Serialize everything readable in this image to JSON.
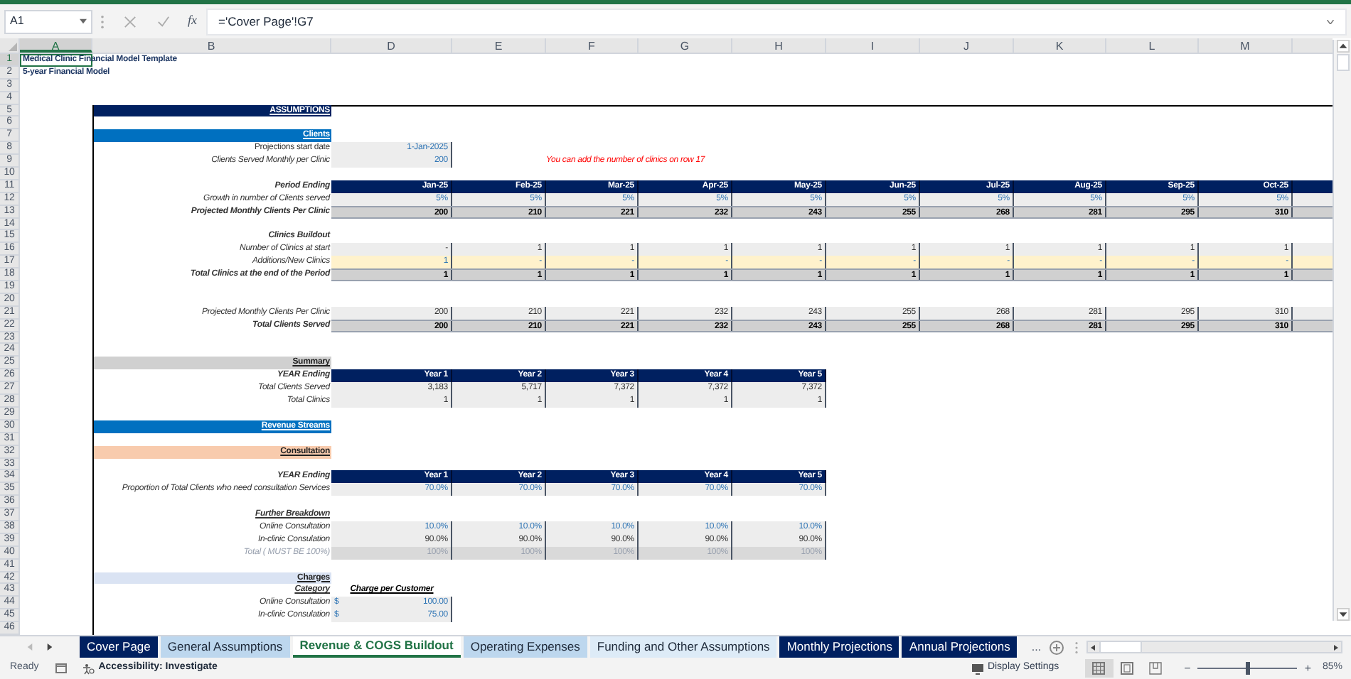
{
  "formula_bar": {
    "name_box": "A1",
    "function_label": "fx",
    "formula": "='Cover Page'!G7"
  },
  "columns": [
    {
      "label": "A",
      "selected": true
    },
    {
      "label": "B",
      "selected": false
    },
    {
      "label": "D",
      "selected": false
    },
    {
      "label": "E",
      "selected": false
    },
    {
      "label": "F",
      "selected": false
    },
    {
      "label": "G",
      "selected": false
    },
    {
      "label": "H",
      "selected": false
    },
    {
      "label": "I",
      "selected": false
    },
    {
      "label": "J",
      "selected": false
    },
    {
      "label": "K",
      "selected": false
    },
    {
      "label": "L",
      "selected": false
    },
    {
      "label": "M",
      "selected": false
    }
  ],
  "rows": [
    {
      "n": "1",
      "selected": true,
      "kind": "title",
      "label": "Medical Clinic Financial Model Template"
    },
    {
      "n": "2",
      "selected": false,
      "kind": "title",
      "label": "5-year Financial  Model"
    },
    {
      "n": "3",
      "selected": false,
      "kind": "blank"
    },
    {
      "n": "4",
      "selected": false,
      "kind": "blank"
    },
    {
      "n": "5",
      "selected": false,
      "kind": "band",
      "color": "#002060",
      "label": "ASSUMPTIONS"
    },
    {
      "n": "6",
      "selected": false,
      "kind": "blank"
    },
    {
      "n": "7",
      "selected": false,
      "kind": "band",
      "color": "#0070c0",
      "label": "Clients"
    },
    {
      "n": "8",
      "selected": false,
      "kind": "date",
      "label": "Projections  start date",
      "values": [
        "1-Jan-2025"
      ]
    },
    {
      "n": "9",
      "selected": false,
      "kind": "input",
      "label": "Clients Served  Monthly per Clinic",
      "values": [
        "200"
      ],
      "note": "You can add the number of clinics on row 17"
    },
    {
      "n": "10",
      "selected": false,
      "kind": "blank"
    },
    {
      "n": "11",
      "selected": false,
      "kind": "header",
      "label": "Period Ending",
      "values": [
        "Jan-25",
        "Feb-25",
        "Mar-25",
        "Apr-25",
        "May-25",
        "Jun-25",
        "Jul-25",
        "Aug-25",
        "Sep-25",
        "Oct-25"
      ]
    },
    {
      "n": "12",
      "selected": false,
      "kind": "input",
      "label": "Growth in number of Clients served",
      "values": [
        "5%",
        "5%",
        "5%",
        "5%",
        "5%",
        "5%",
        "5%",
        "5%",
        "5%",
        "5%"
      ]
    },
    {
      "n": "13",
      "selected": false,
      "kind": "total",
      "label": "Projected  Monthly Clients Per Clinic",
      "values": [
        "200",
        "210",
        "221",
        "232",
        "243",
        "255",
        "268",
        "281",
        "295",
        "310"
      ]
    },
    {
      "n": "14",
      "selected": false,
      "kind": "blank"
    },
    {
      "n": "15",
      "selected": false,
      "kind": "subhead",
      "underlined": false,
      "label": "Clinics Buildout"
    },
    {
      "n": "16",
      "selected": false,
      "kind": "calc",
      "label": "Number of Clinics at start",
      "values": [
        "-",
        "1",
        "1",
        "1",
        "1",
        "1",
        "1",
        "1",
        "1",
        "1"
      ]
    },
    {
      "n": "17",
      "selected": false,
      "kind": "yellow",
      "label": "Additions/New Clinics",
      "values": [
        "1",
        "-",
        "-",
        "-",
        "-",
        "-",
        "-",
        "-",
        "-",
        "-"
      ]
    },
    {
      "n": "18",
      "selected": false,
      "kind": "total",
      "label": "Total Clinics at the end of the  Period",
      "values": [
        "1",
        "1",
        "1",
        "1",
        "1",
        "1",
        "1",
        "1",
        "1",
        "1"
      ]
    },
    {
      "n": "19",
      "selected": false,
      "kind": "blank"
    },
    {
      "n": "20",
      "selected": false,
      "kind": "blank"
    },
    {
      "n": "21",
      "selected": false,
      "kind": "calc",
      "label": "Projected  Monthly Clients Per Clinic",
      "values": [
        "200",
        "210",
        "221",
        "232",
        "243",
        "255",
        "268",
        "281",
        "295",
        "310"
      ]
    },
    {
      "n": "22",
      "selected": false,
      "kind": "total",
      "label": "Total Clients Served",
      "values": [
        "200",
        "210",
        "221",
        "232",
        "243",
        "255",
        "268",
        "281",
        "295",
        "310"
      ]
    },
    {
      "n": "23",
      "selected": false,
      "kind": "blank"
    },
    {
      "n": "24",
      "selected": false,
      "kind": "blank"
    },
    {
      "n": "25",
      "selected": false,
      "kind": "band",
      "color": "#d0d0d0",
      "label": "Summary"
    },
    {
      "n": "26",
      "selected": false,
      "kind": "header",
      "label": "YEAR Ending",
      "values": [
        "Year 1",
        "Year 2",
        "Year 3",
        "Year 4",
        "Year 5"
      ]
    },
    {
      "n": "27",
      "selected": false,
      "kind": "calc",
      "label": "Total Clients Served",
      "values": [
        "3,183",
        "5,717",
        "7,372",
        "7,372",
        "7,372"
      ]
    },
    {
      "n": "28",
      "selected": false,
      "kind": "calc",
      "label": "Total Clinics",
      "values": [
        "1",
        "1",
        "1",
        "1",
        "1"
      ]
    },
    {
      "n": "29",
      "selected": false,
      "kind": "blank"
    },
    {
      "n": "30",
      "selected": false,
      "kind": "band",
      "color": "#0070c0",
      "label": "Revenue Streams"
    },
    {
      "n": "31",
      "selected": false,
      "kind": "blank"
    },
    {
      "n": "32",
      "selected": false,
      "kind": "band",
      "color": "#f8cbad",
      "label": "Consultation"
    },
    {
      "n": "33",
      "selected": false,
      "kind": "blank"
    },
    {
      "n": "34",
      "selected": false,
      "kind": "header",
      "label": "YEAR Ending",
      "values": [
        "Year 1",
        "Year 2",
        "Year 3",
        "Year 4",
        "Year 5"
      ]
    },
    {
      "n": "35",
      "selected": false,
      "kind": "input",
      "label": "Proportion of Total Clients who need consultation Services",
      "values": [
        "70.0%",
        "70.0%",
        "70.0%",
        "70.0%",
        "70.0%"
      ]
    },
    {
      "n": "36",
      "selected": false,
      "kind": "blank"
    },
    {
      "n": "37",
      "selected": false,
      "kind": "subhead",
      "underlined": true,
      "label": "Further Breakdown"
    },
    {
      "n": "38",
      "selected": false,
      "kind": "input",
      "label": "Online Consultation",
      "values": [
        "10.0%",
        "10.0%",
        "10.0%",
        "10.0%",
        "10.0%"
      ]
    },
    {
      "n": "39",
      "selected": false,
      "kind": "calc",
      "label": "In-clinic Consulation",
      "values": [
        "90.0%",
        "90.0%",
        "90.0%",
        "90.0%",
        "90.0%"
      ]
    },
    {
      "n": "40",
      "selected": false,
      "kind": "muted",
      "label": "Total ( MUST BE 100%)",
      "values": [
        "100%",
        "100%",
        "100%",
        "100%",
        "100%"
      ]
    },
    {
      "n": "41",
      "selected": false,
      "kind": "blank"
    },
    {
      "n": "42",
      "selected": false,
      "kind": "band",
      "color": "#dae3f3",
      "label": "Charges"
    },
    {
      "n": "43",
      "selected": false,
      "kind": "colhead",
      "label": "Category",
      "values": [
        "Charge per Customer"
      ]
    },
    {
      "n": "44",
      "selected": false,
      "kind": "money",
      "label": "Online Consultation",
      "currency": "$",
      "values": [
        "100.00"
      ]
    },
    {
      "n": "45",
      "selected": false,
      "kind": "money",
      "label": "In-clinic Consulation",
      "currency": "$",
      "values": [
        "75.00"
      ]
    },
    {
      "n": "46",
      "selected": false,
      "kind": "blank"
    }
  ],
  "sheet_tabs": {
    "more": "...",
    "tabs": [
      {
        "label": "Cover Page",
        "selected": false,
        "color": "#002060"
      },
      {
        "label": "General Assumptions",
        "selected": false,
        "color": "#bdd7ee"
      },
      {
        "label": "Revenue & COGS Buildout",
        "selected": true,
        "color": "#ffffff"
      },
      {
        "label": "Operating Expenses",
        "selected": false,
        "color": "#bdd7ee"
      },
      {
        "label": "Funding and Other Assumptions",
        "selected": false,
        "color": "#ddebf7"
      },
      {
        "label": "Monthly Projections",
        "selected": false,
        "color": "#002060"
      },
      {
        "label": "Annual Projections",
        "selected": false,
        "color": "#002060"
      }
    ]
  },
  "status_bar": {
    "ready": "Ready",
    "accessibility": "Accessibility: Investigate",
    "display_settings": "Display Settings",
    "views": [
      {
        "kind": "normal",
        "selected": true
      },
      {
        "kind": "page_layout",
        "selected": false
      },
      {
        "kind": "page_break",
        "selected": false
      }
    ],
    "zoom_out": "−",
    "zoom": {
      "level": 0.5
    },
    "zoom_in": "+",
    "zoom_reading": "85%"
  }
}
